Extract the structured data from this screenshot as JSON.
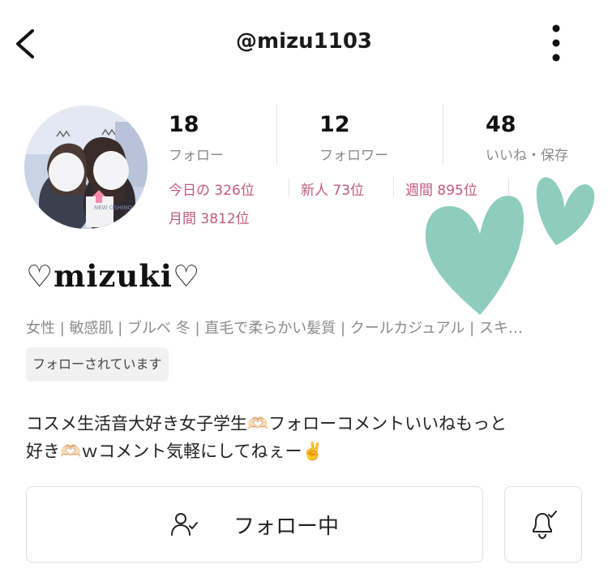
{
  "header": {
    "username": "@mizu1103",
    "back_icon": "chevron-left-icon",
    "more_icon": "more-vertical-icon"
  },
  "profile": {
    "display_name": "♡mizuki♡",
    "stats": [
      {
        "value": "18",
        "label": "フォロー"
      },
      {
        "value": "12",
        "label": "フォロワー"
      },
      {
        "value": "48",
        "label": "いいね・保存"
      }
    ],
    "rankings": [
      {
        "label": "今日の",
        "value": "326",
        "unit": "位"
      },
      {
        "label": "新人",
        "value": "73",
        "unit": "位"
      },
      {
        "label": "週間",
        "value": "895",
        "unit": "位"
      },
      {
        "label": "月間",
        "value": "3812",
        "unit": "位"
      }
    ],
    "tags": "女性 | 敏感肌 | ブルベ 冬 | 直毛で柔らかい髪質 | クールカジュアル | スキ…",
    "follows_you_label": "フォローされています",
    "bio_line1": "コスメ生活音大好き女子学生🫶🏻フォローコメントいいねもっと",
    "bio_line2": "好き🫶🏻ｗコメント気軽にしてねぇー✌️",
    "avatar_text": "NEW OSHINO GOODS"
  },
  "actions": {
    "follow_label": "フォロー中",
    "follow_icon": "user-check-icon",
    "bell_icon": "bell-check-icon"
  },
  "colors": {
    "ranking": "#c15a80",
    "heart_overlay": "#8ecdbb",
    "muted_text": "#8a8a8a",
    "border": "#e0e0e0"
  }
}
